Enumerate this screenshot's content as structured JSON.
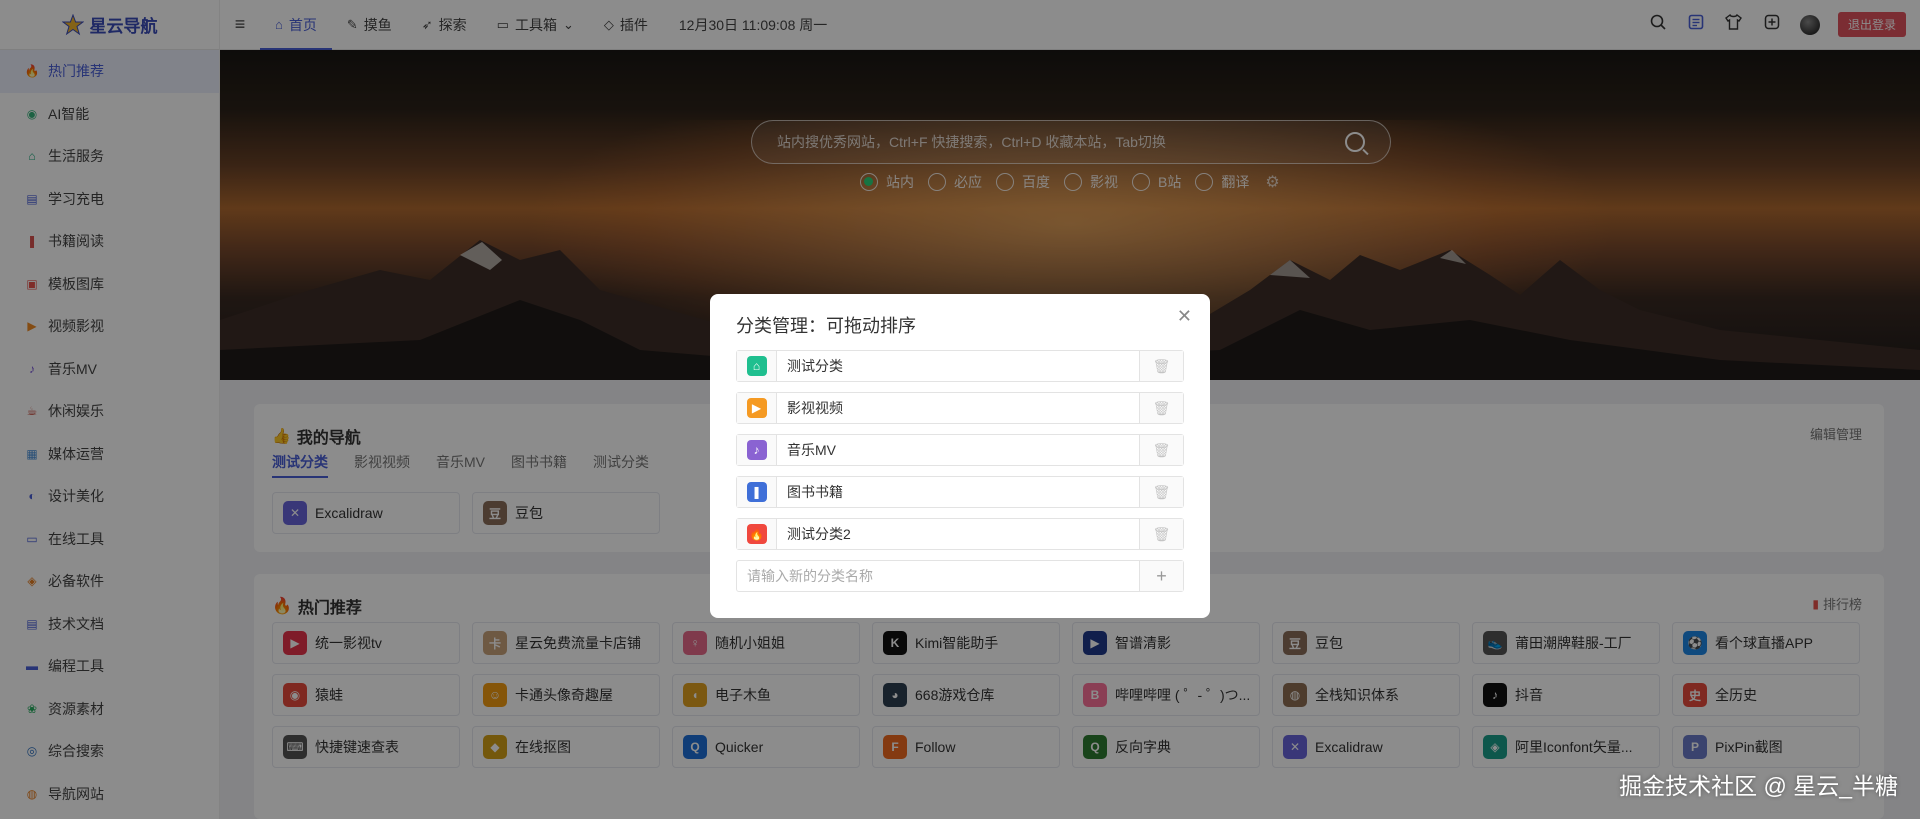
{
  "logo": {
    "text": "星云导航"
  },
  "topnav": [
    {
      "label": "首页",
      "icon": "home-icon",
      "glyph": "⌂",
      "active": true
    },
    {
      "label": "摸鱼",
      "icon": "fish-icon",
      "glyph": "✎"
    },
    {
      "label": "探索",
      "icon": "compass-icon",
      "glyph": "➶"
    },
    {
      "label": "工具箱",
      "icon": "toolbox-icon",
      "glyph": "▭",
      "dropdown": true
    },
    {
      "label": "插件",
      "icon": "plugin-icon",
      "glyph": "◇"
    }
  ],
  "datetime": "12月30日 11:09:08 周一",
  "topright": {
    "logout_label": "退出登录"
  },
  "sidebar": [
    {
      "label": "热门推荐",
      "icon": "fire-icon",
      "glyph": "🔥",
      "color": "#e8534b",
      "active": true
    },
    {
      "label": "AI智能",
      "icon": "ai-icon",
      "glyph": "◉",
      "color": "#33b37a"
    },
    {
      "label": "生活服务",
      "icon": "life-icon",
      "glyph": "⌂",
      "color": "#1aa97b"
    },
    {
      "label": "学习充电",
      "icon": "study-icon",
      "glyph": "▤",
      "color": "#4a5fd8"
    },
    {
      "label": "书籍阅读",
      "icon": "book-icon",
      "glyph": "❚",
      "color": "#d9534f"
    },
    {
      "label": "模板图库",
      "icon": "template-icon",
      "glyph": "▣",
      "color": "#e8534b"
    },
    {
      "label": "视频影视",
      "icon": "video-icon",
      "glyph": "▶",
      "color": "#f08a24"
    },
    {
      "label": "音乐MV",
      "icon": "music-icon",
      "glyph": "♪",
      "color": "#7a55d8"
    },
    {
      "label": "休闲娱乐",
      "icon": "leisure-icon",
      "glyph": "☕",
      "color": "#c0392b"
    },
    {
      "label": "媒体运营",
      "icon": "media-icon",
      "glyph": "▦",
      "color": "#4a90d9"
    },
    {
      "label": "设计美化",
      "icon": "design-icon",
      "glyph": "◐",
      "color": "#4a5fd8"
    },
    {
      "label": "在线工具",
      "icon": "tools-icon",
      "glyph": "▭",
      "color": "#4a5fd8"
    },
    {
      "label": "必备软件",
      "icon": "software-icon",
      "glyph": "◈",
      "color": "#e67e22"
    },
    {
      "label": "技术文档",
      "icon": "docs-icon",
      "glyph": "▤",
      "color": "#4a5fd8"
    },
    {
      "label": "编程工具",
      "icon": "code-icon",
      "glyph": "▬",
      "color": "#4a5fd8"
    },
    {
      "label": "资源素材",
      "icon": "resource-icon",
      "glyph": "❀",
      "color": "#27ae60"
    },
    {
      "label": "综合搜索",
      "icon": "search-icon",
      "glyph": "◎",
      "color": "#2c6fbe"
    },
    {
      "label": "导航网站",
      "icon": "globe-icon",
      "glyph": "◍",
      "color": "#e67e22"
    }
  ],
  "search": {
    "placeholder": "站内搜优秀网站，Ctrl+F 快捷搜索，Ctrl+D 收藏本站，Tab切换",
    "engines": [
      {
        "label": "站内",
        "selected": true
      },
      {
        "label": "必应"
      },
      {
        "label": "百度"
      },
      {
        "label": "影视"
      },
      {
        "label": "B站"
      },
      {
        "label": "翻译"
      }
    ]
  },
  "my_nav": {
    "title": "我的导航",
    "manage_label": "编辑管理",
    "tabs": [
      "测试分类",
      "影视视频",
      "音乐MV",
      "图书书籍",
      "测试分类"
    ],
    "items": [
      {
        "label": "Excalidraw",
        "icon": "excalidraw-icon",
        "glyph": "✕",
        "color": "#6965db"
      },
      {
        "label": "豆包",
        "icon": "doubao-icon",
        "glyph": "豆",
        "color": "#8a6d5a"
      }
    ]
  },
  "hot": {
    "title": "热门推荐",
    "rank_label": "排行榜",
    "items": [
      {
        "label": "统一影视tv",
        "icon": "video-app-icon",
        "glyph": "▶",
        "color": "#e8344b"
      },
      {
        "label": "星云免费流量卡店铺",
        "icon": "shop-icon",
        "glyph": "卡",
        "color": "#c8a27a"
      },
      {
        "label": "随机小姐姐",
        "icon": "girl-icon",
        "glyph": "♀",
        "color": "#e86a8a"
      },
      {
        "label": "Kimi智能助手",
        "icon": "kimi-icon",
        "glyph": "K",
        "color": "#111111"
      },
      {
        "label": "智谱清影",
        "icon": "zhipu-icon",
        "glyph": "▶",
        "color": "#1f3a8a"
      },
      {
        "label": "豆包",
        "icon": "doubao-icon",
        "glyph": "豆",
        "color": "#8a6d5a"
      },
      {
        "label": "莆田潮牌鞋服-工厂",
        "icon": "shoe-icon",
        "glyph": "👟",
        "color": "#555555"
      },
      {
        "label": "看个球直播APP",
        "icon": "ball-icon",
        "glyph": "⚽",
        "color": "#1e88e5"
      },
      {
        "label": "猿蛙",
        "icon": "frog-icon",
        "glyph": "◉",
        "color": "#e74c3c"
      },
      {
        "label": "卡通头像奇趣屋",
        "icon": "cartoon-icon",
        "glyph": "☺",
        "color": "#f39c12"
      },
      {
        "label": "电子木鱼",
        "icon": "woodfish-icon",
        "glyph": "◖",
        "color": "#e0a020"
      },
      {
        "label": "668游戏仓库",
        "icon": "game-icon",
        "glyph": "◕",
        "color": "#2c3e50"
      },
      {
        "label": "哔哩哔哩 ( ゜- ゜)つ...",
        "icon": "bilibili-icon",
        "glyph": "B",
        "color": "#fb7299"
      },
      {
        "label": "全栈知识体系",
        "icon": "fullstack-icon",
        "glyph": "◍",
        "color": "#8e6e53"
      },
      {
        "label": "抖音",
        "icon": "douyin-icon",
        "glyph": "♪",
        "color": "#111111"
      },
      {
        "label": "全历史",
        "icon": "history-icon",
        "glyph": "史",
        "color": "#e74c3c"
      },
      {
        "label": "快捷键速查表",
        "icon": "shortcut-icon",
        "glyph": "⌨",
        "color": "#555555"
      },
      {
        "label": "在线抠图",
        "icon": "cutout-icon",
        "glyph": "◆",
        "color": "#d4a017"
      },
      {
        "label": "Quicker",
        "icon": "quicker-icon",
        "glyph": "Q",
        "color": "#1e6fd9"
      },
      {
        "label": "Follow",
        "icon": "follow-icon",
        "glyph": "F",
        "color": "#f06a20"
      },
      {
        "label": "反向字典",
        "icon": "dict-icon",
        "glyph": "Q",
        "color": "#2e7d32"
      },
      {
        "label": "Excalidraw",
        "icon": "excalidraw-icon",
        "glyph": "✕",
        "color": "#6965db"
      },
      {
        "label": "阿里Iconfont矢量...",
        "icon": "iconfont-icon",
        "glyph": "◈",
        "color": "#1b9e8a"
      },
      {
        "label": "PixPin截图",
        "icon": "pixpin-icon",
        "glyph": "P",
        "color": "#6b7ac8"
      }
    ]
  },
  "modal": {
    "title": "分类管理：可拖动排序",
    "categories": [
      {
        "label": "测试分类",
        "icon": "house-icon",
        "glyph": "⌂",
        "color": "#1fbf8f"
      },
      {
        "label": "影视视频",
        "icon": "film-icon",
        "glyph": "▶",
        "color": "#f59a23"
      },
      {
        "label": "音乐MV",
        "icon": "music-note-icon",
        "glyph": "♪",
        "color": "#8a63d2"
      },
      {
        "label": "图书书籍",
        "icon": "book-icon",
        "glyph": "❚",
        "color": "#3f6fd8"
      },
      {
        "label": "测试分类2",
        "icon": "fire-icon",
        "glyph": "🔥",
        "color": "#f0483e"
      }
    ],
    "new_placeholder": "请输入新的分类名称"
  },
  "watermark": "掘金技术社区 @ 星云_半糖"
}
